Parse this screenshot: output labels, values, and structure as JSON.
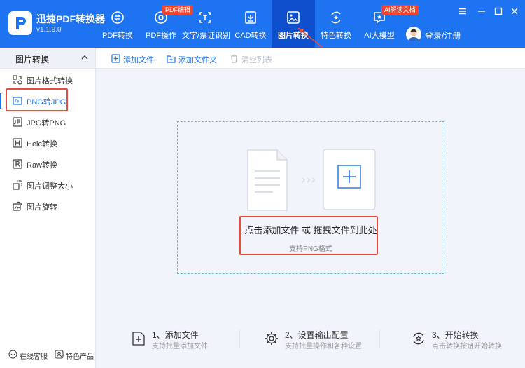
{
  "app": {
    "name": "迅捷PDF转换器",
    "version": "v1.1.9.0"
  },
  "nav": [
    {
      "label": "PDF转换",
      "icon": "pdf-convert-icon"
    },
    {
      "label": "PDF操作",
      "icon": "pdf-operate-icon",
      "badge": "PDF编辑"
    },
    {
      "label": "文字/票证识别",
      "icon": "ocr-icon"
    },
    {
      "label": "CAD转换",
      "icon": "cad-icon"
    },
    {
      "label": "图片转换",
      "icon": "image-convert-icon",
      "active": true
    },
    {
      "label": "特色转换",
      "icon": "special-convert-icon"
    },
    {
      "label": "AI大模型",
      "icon": "ai-model-icon",
      "badge": "AI解读文档"
    }
  ],
  "user": {
    "label": "登录/注册"
  },
  "sidebar": {
    "title": "图片转换",
    "items": [
      {
        "label": "图片格式转换",
        "icon": "format-convert-icon"
      },
      {
        "label": "PNG转JPG",
        "icon": "png-to-jpg-icon",
        "active": true
      },
      {
        "label": "JPG转PNG",
        "icon": "jpg-to-png-icon"
      },
      {
        "label": "Heic转换",
        "icon": "heic-icon"
      },
      {
        "label": "Raw转换",
        "icon": "raw-icon"
      },
      {
        "label": "图片调整大小",
        "icon": "resize-icon"
      },
      {
        "label": "图片旋转",
        "icon": "rotate-icon"
      }
    ],
    "footer": {
      "service": "在线客服",
      "products": "特色产品"
    }
  },
  "toolbar": {
    "add_file": "添加文件",
    "add_folder": "添加文件夹",
    "clear_list": "清空列表"
  },
  "dropzone": {
    "text": "点击添加文件 或 拖拽文件到此处",
    "subtext": "支持PNG格式"
  },
  "steps": [
    {
      "title": "1、添加文件",
      "desc": "支持批量添加文件"
    },
    {
      "title": "2、设置输出配置",
      "desc": "支持批量操作和各种设置"
    },
    {
      "title": "3、开始转换",
      "desc": "点击转换按钮开始转换"
    }
  ],
  "colors": {
    "brand": "#1e73f0",
    "active_nav": "#0d4fcc",
    "badge": "#f3452e",
    "highlight_box": "#e74c3c"
  }
}
